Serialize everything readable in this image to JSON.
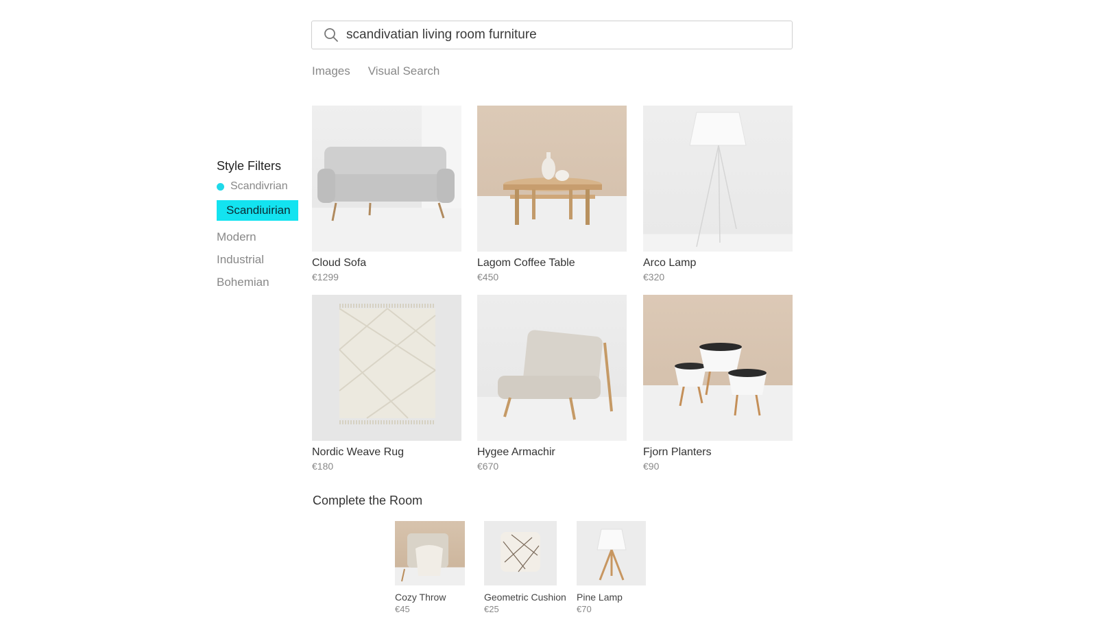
{
  "search": {
    "value": "scandivatian living room furniture"
  },
  "tabs": [
    "Images",
    "Visual Search"
  ],
  "filters": {
    "title": "Style Filters",
    "radio_label": "Scandivrian",
    "active_label": "Scandiuirian",
    "items": [
      "Modern",
      "Industrial",
      "Bohemian"
    ],
    "accent": "#13e3f0"
  },
  "products": [
    {
      "name": "Cloud Sofa",
      "price": "€1299",
      "icon": "sofa"
    },
    {
      "name": "Lagom Coffee Table",
      "price": "€450",
      "icon": "coffee-table"
    },
    {
      "name": "Arco Lamp",
      "price": "€320",
      "icon": "floor-lamp"
    },
    {
      "name": "Nordic Weave Rug",
      "price": "€180",
      "icon": "rug"
    },
    {
      "name": "Hygee Armachir",
      "price": "€670",
      "icon": "armchair"
    },
    {
      "name": "Fjorn Planters",
      "price": "€90",
      "icon": "planters"
    }
  ],
  "complete_room": {
    "title": "Complete the Room",
    "items": [
      {
        "name": "Cozy Throw",
        "price": "€45",
        "icon": "throw-blanket"
      },
      {
        "name": "Geometric Cushion",
        "price": "€25",
        "icon": "cushion"
      },
      {
        "name": "Pine Lamp",
        "price": "€70",
        "icon": "table-lamp"
      }
    ]
  }
}
